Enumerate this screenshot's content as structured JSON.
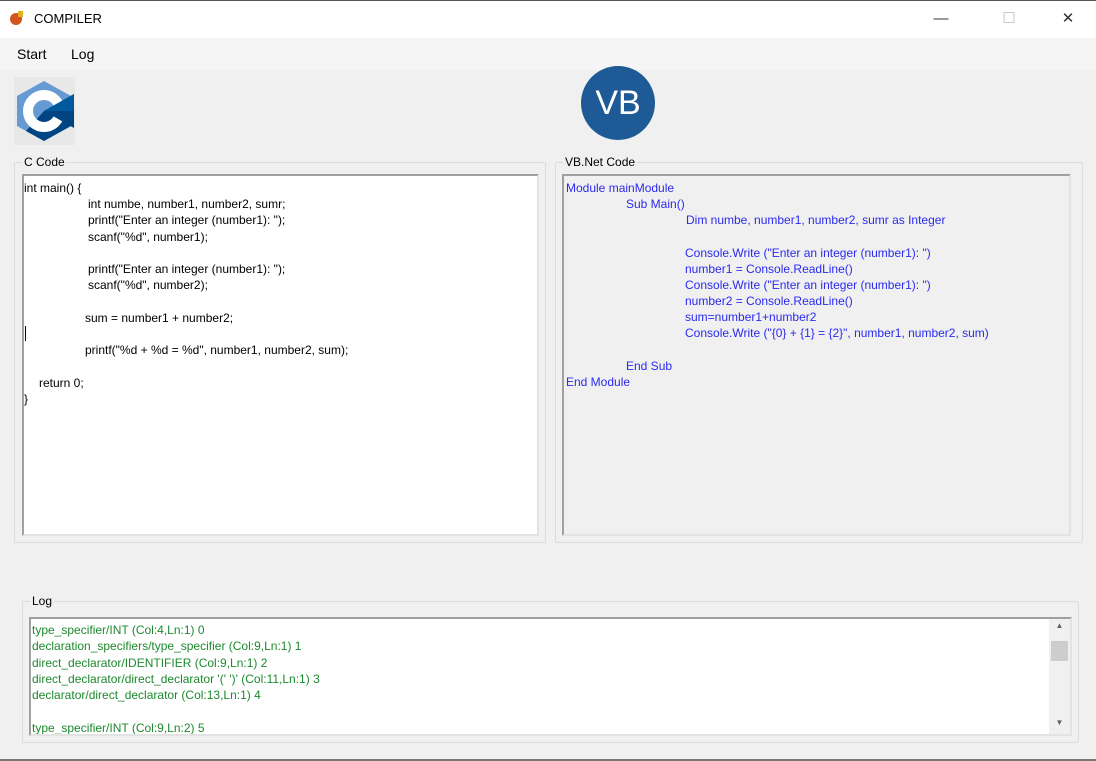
{
  "window": {
    "title": "COMPILER",
    "minimize": "—",
    "maximize": "☐",
    "close": "✕"
  },
  "menu": {
    "start": "Start",
    "log": "Log"
  },
  "logos": {
    "c": "C",
    "vb": "VB"
  },
  "colors": {
    "c_logo_light": "#659ad2",
    "c_logo_dark": "#004482",
    "vb_logo": "#1d5a96",
    "vb_text": "#2a2af0",
    "log_text": "#1c8a2e"
  },
  "c_code": {
    "label": "C Code",
    "lines": [
      "int main() {",
      "int numbe, number1, number2, sumr;",
      "printf(\"Enter an integer (number1): \");",
      "scanf(\"%d\", number1);",
      "printf(\"Enter an integer (number1): \");",
      "scanf(\"%d\", number2);",
      "sum = number1 + number2;",
      "printf(\"%d + %d = %d\", number1, number2, sum);",
      "return 0;",
      "}"
    ]
  },
  "vb_code": {
    "label": "VB.Net  Code",
    "lines": [
      "Module mainModule",
      "Sub Main()",
      "Dim numbe, number1, number2, sumr as Integer",
      "Console.Write (\"Enter an integer (number1): \")",
      "number1 = Console.ReadLine()",
      "Console.Write (\"Enter an integer (number1): \")",
      "number2 = Console.ReadLine()",
      "sum=number1+number2",
      "Console.Write (\"{0} + {1} = {2}\", number1, number2, sum)",
      "End Sub",
      "End Module"
    ]
  },
  "log": {
    "label": "Log",
    "lines": [
      "type_specifier/INT (Col:4,Ln:1) 0",
      "declaration_specifiers/type_specifier (Col:9,Ln:1) 1",
      "direct_declarator/IDENTIFIER (Col:9,Ln:1) 2",
      "direct_declarator/direct_declarator '(' ')' (Col:11,Ln:1) 3",
      "declarator/direct_declarator (Col:13,Ln:1) 4",
      "type_specifier/INT (Col:9,Ln:2) 5"
    ],
    "scroll_up": "▲",
    "scroll_down": "▼"
  }
}
